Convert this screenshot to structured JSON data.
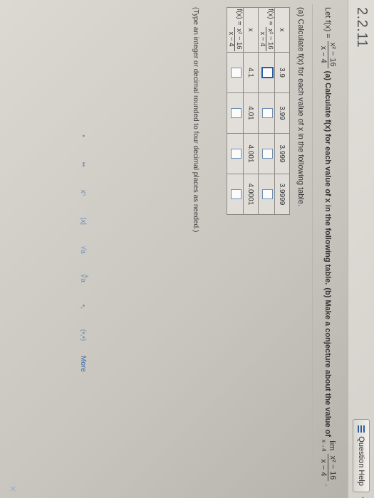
{
  "header": {
    "section": "2.2.11",
    "help_label": "Question Help",
    "help_extra": "‹"
  },
  "question": {
    "let": "Let f(x) =",
    "f_num": "x² − 16",
    "f_den": "x − 4",
    "part_a": "(a) Calculate f(x) for each value of x in the following table.",
    "part_b": "(b) Make a conjecture about the value of",
    "lim_word": "lim",
    "lim_sub": "x→4",
    "end": "."
  },
  "instruction": "(a) Calculate f(x) for each value of x in the following table.",
  "table": {
    "x_label": "x",
    "fx_label": "f(x) =",
    "row1_x": [
      "3.9",
      "3.99",
      "3.999",
      "3.9999"
    ],
    "row2_x": [
      "4.1",
      "4.01",
      "4.001",
      "4.0001"
    ]
  },
  "hint": "(Type an integer or decimal rounded to four decimal places as needed.)",
  "toolbar": {
    "tools": [
      "•",
      "••",
      "xⁿ",
      "|x|",
      "√a",
      "∛a",
      "•,",
      "(•,•)"
    ],
    "more": "More"
  },
  "close": "✕"
}
